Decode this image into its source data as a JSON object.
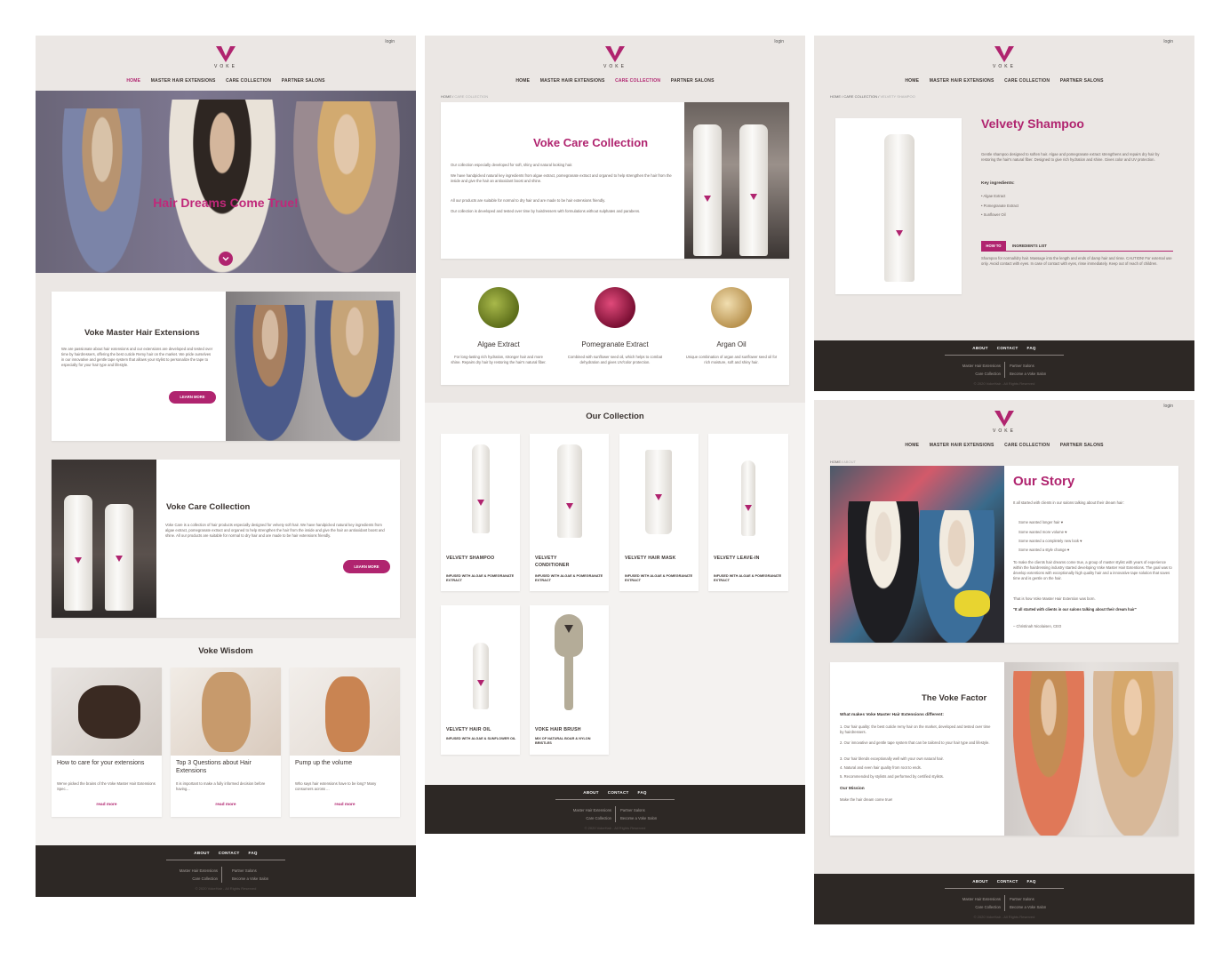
{
  "brand": {
    "name": "VOKE",
    "login": "login"
  },
  "nav": {
    "home": "HOME",
    "extensions": "MASTER HAIR EXTENSIONS",
    "care": "CARE COLLECTION",
    "salons": "PARTNER SALONS"
  },
  "footer": {
    "about": "ABOUT",
    "contact": "CONTACT",
    "faq": "FAQ",
    "col1a": "Master Hair Extensions",
    "col1b": "Care Collection",
    "col2a": "Partner Salons",
    "col2b": "Become a Voke Salon",
    "copyright": "© 2020 VokeHair - All Rights Reserved"
  },
  "home": {
    "hero_title": "Hair Dreams Come True!",
    "ext_title": "Voke Master Hair Extensions",
    "ext_text": "We are passionate about hair extensions and our extensions are developed and tested over time by hairdressers, offering the best cuticle Remy hair on the market. We pride ourselves in our innovative and gentle tape system that allows your stylist to personalize the tape to especially for your hair type and lifestyle.",
    "learn_more": "LEARN MORE",
    "care_title": "Voke Care Collection",
    "care_text": "Voke Care is a collection of hair products especially designed for velvety soft hair. We have handpicked natural key ingredients from algae extract, pomegranate extract and organed to help strengthen the hair from the inside and give the hair an antioxidant boost and shine. All our products are suitable for normal to dry hair and are made to be hair extensions friendly.",
    "wisdom_title": "Voke Wisdom",
    "articles": [
      {
        "title": "How to care for your extensions",
        "text": "We've picked the brains of the Voke Master Hair Extensions Spec...",
        "link": "read more"
      },
      {
        "title": "Top 3 Questions about Hair Extensions",
        "text": "It is important to make a fully informed decision before having...",
        "link": "read more"
      },
      {
        "title": "Pump up the volume",
        "text": "Who says hair extensions have to be long? Many consumers across ...",
        "link": "read more"
      }
    ]
  },
  "care": {
    "crumb_home": "HOME",
    "crumb_sep": " / ",
    "crumb_current": "CARE COLLECTION",
    "title": "Voke Care Collection",
    "p1": "Our collection especially developed for soft, shiny and natural looking hair.",
    "p2": "We have handpicked natural key ingredients from algae extract, pomegranate extract and organed to help strengthen the hair from the inside and give the hair an antioxidant boost and shine.",
    "p3": "All our products are suitable for normal to dry hair and are made to be hair extensions friendly.",
    "p4": "Our collection is developed and tested over time by hairdressers with formulations without sulphates and parabens.",
    "ingredients": [
      {
        "name": "Algae Extract",
        "text": "For long-lasting rich hydration, stronger hair and more shine. Repairs dry hair by restoring the hair's natural fiber.",
        "color": "#7a8a2a"
      },
      {
        "name": "Pomegranate Extract",
        "text": "Combined with sunflower seed oil, which helps to combat dehydration and gives UV/color protection.",
        "color": "#b3204f"
      },
      {
        "name": "Argan Oil",
        "text": "Unique combination of argan and sunflower seed oil for rich moisture, soft and shiny hair.",
        "color": "#d9b77a"
      }
    ],
    "collection_title": "Our Collection",
    "products": [
      {
        "name": "VELVETY SHAMPOO",
        "sub": "INFUSED WITH ALGAE & POMEGRANATE EXTRACT"
      },
      {
        "name": "VELVETY CONDITIONER",
        "sub": "INFUSED WITH ALGAE & POMEGRANATE EXTRACT"
      },
      {
        "name": "VELVETY HAIR MASK",
        "sub": "INFUSED WITH ALGAE & POMEGRANATE EXTRACT"
      },
      {
        "name": "VELVETY LEAVE-IN",
        "sub": "INFUSED WITH ALGAE & POMEGRANATE EXTRACT"
      },
      {
        "name": "VELVETY HAIR OIL",
        "sub": "INFUSED WITH ALGAE & SUNFLOWER OIL"
      },
      {
        "name": "VOKE HAIR BRUSH",
        "sub": "MIX OF NATURAL BOAR & NYLON BRISTLES"
      }
    ]
  },
  "product": {
    "crumb_home": "HOME",
    "crumb_care": "CARE COLLECTION",
    "crumb_current": "VELVETY SHAMPOO",
    "title": "Velvety Shampoo",
    "desc": "Gentle shampoo designed to soften hair. Algae and pomegranate extract strengthens and repairs dry hair by restoring the hair's natural fiber. Designed to give rich hydration and shine. Gives color and UV protection.",
    "key_label": "Key ingredients:",
    "ingredients": [
      "Algae Extract",
      "Pomegranate Extract",
      "Sunflower Oil"
    ],
    "tab_how": "HOW TO",
    "tab_list": "INGREDIENTS LIST",
    "howto": "Shampoo for normal/dry hair. Massage into the length and ends of damp hair and rinse. CAUTION! For external use only. Avoid contact with eyes. In case of contact with eyes, rinse immediately. Keep out of reach of children."
  },
  "about": {
    "crumb_home": "HOME",
    "crumb_current": "ABOUT",
    "title": "Our Story",
    "intro": "It all started with clients in our salons talking about their dream hair:",
    "wants": [
      "Some wanted longer hair ♥",
      "Some wanted more volume ♥",
      "Some wanted a completely new look ♥",
      "Some wanted a style change ♥"
    ],
    "body": "To make the clients hair dreams come true, a group of master stylist with years of experience within the hairdressing industry started developing Voke Master Hair Extentions. The goal was to develop extentions with exceptionally high quality hair and a innovative tape solution that saves time and is gentle on the hair.",
    "born": "That is how Voke Master Hair Extention was born.",
    "quote": "\"It all started with clients in our salons talking about their dream hair\"",
    "author": "– Christinah Nicolaisen, CEO",
    "factor_title": "The Voke Factor",
    "factor_q": "What makes Voke Master Hair Extensions different:",
    "factors": [
      "1. Our hair quality: the best cuticle remy hair on the market, developed and tested over time by hairdressers.",
      "2. Our innovative and gentle tape system that can be tailored to your hair type and lifestyle.",
      "3. Our hair blends exceptionally well with your own natural hair.",
      "4. Natural and even hair quality from root to ends.",
      "5. Recommended by stylists and performed by certified stylists."
    ],
    "mission_label": "Our Mission",
    "mission": "Make the hair dream come true!"
  },
  "colors": {
    "accent": "#b0246f",
    "bg": "#ebe7e4",
    "footer": "#2d2825"
  }
}
